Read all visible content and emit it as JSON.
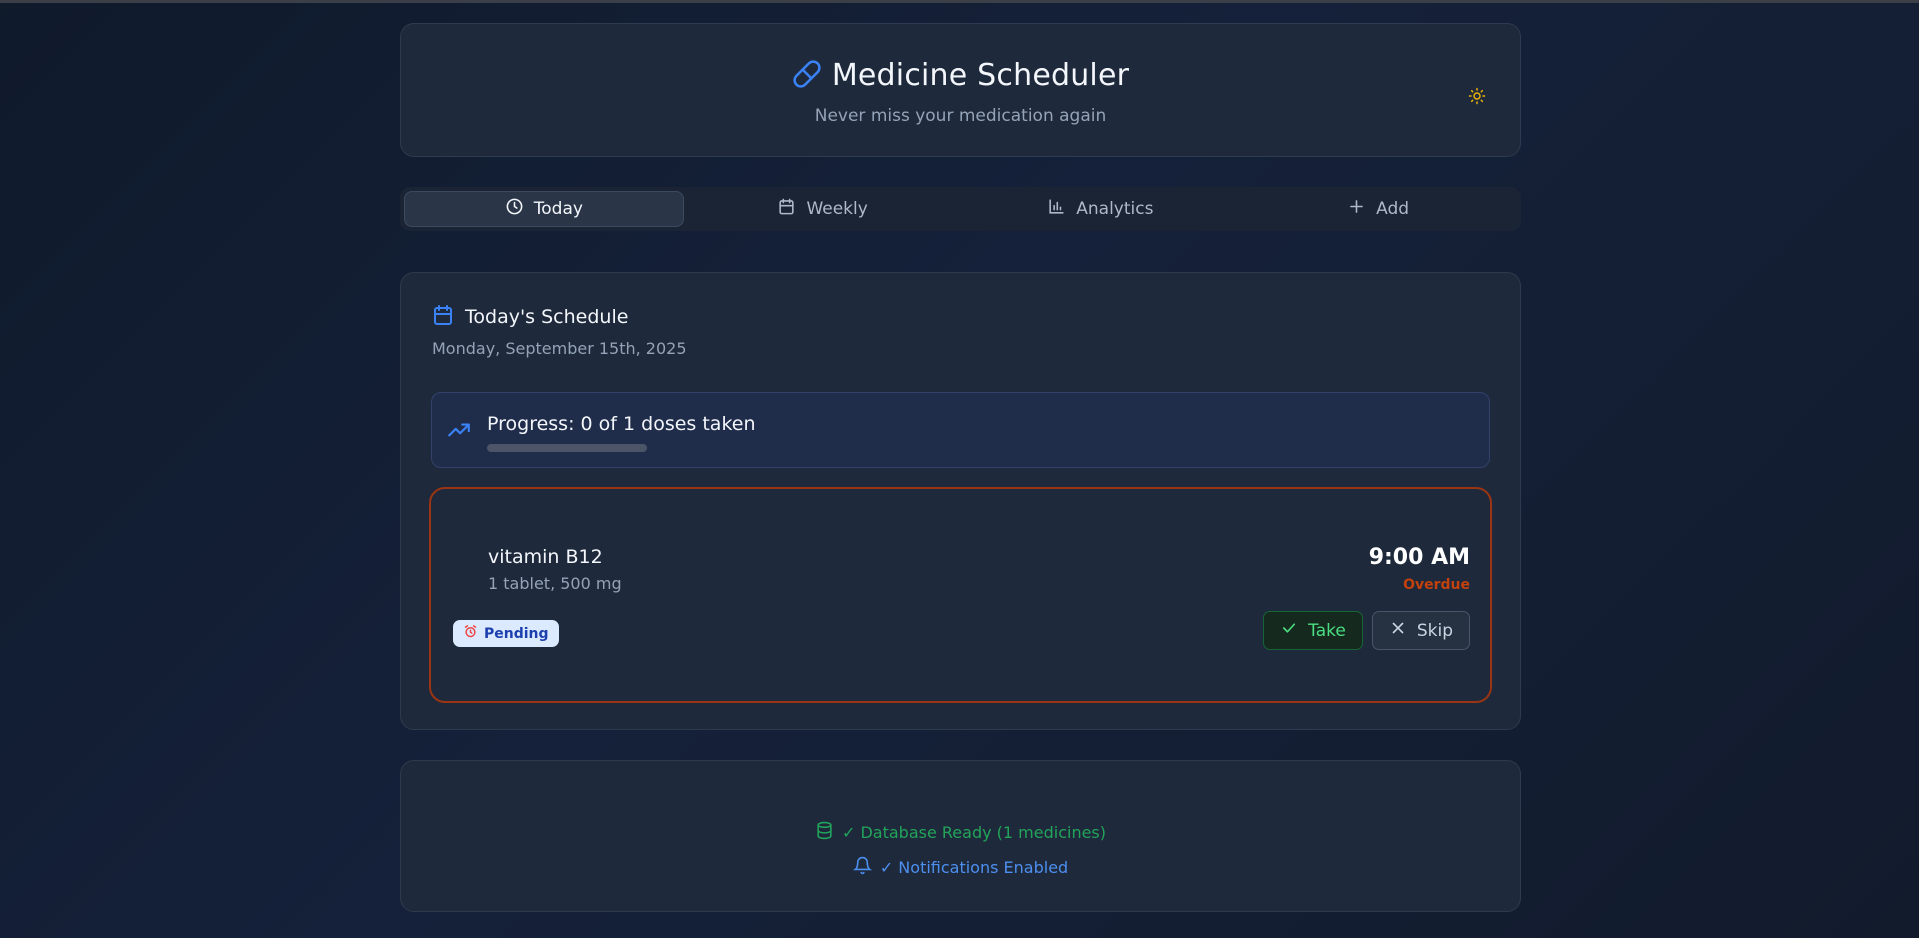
{
  "header": {
    "title": "Medicine Scheduler",
    "subtitle": "Never miss your medication again",
    "theme_icon": "sun-icon"
  },
  "tabs": [
    {
      "label": "Today",
      "icon": "clock-icon",
      "active": true
    },
    {
      "label": "Weekly",
      "icon": "calendar-icon",
      "active": false
    },
    {
      "label": "Analytics",
      "icon": "bar-chart-icon",
      "active": false
    },
    {
      "label": "Add",
      "icon": "plus-icon",
      "active": false
    }
  ],
  "schedule": {
    "title": "Today's Schedule",
    "date": "Monday, September 15th, 2025",
    "progress": {
      "text": "Progress: 0 of 1 doses taken",
      "taken": 0,
      "total": 1
    },
    "doses": [
      {
        "name": "vitamin B12",
        "amount": "1 tablet, 500 mg",
        "status": "Pending",
        "time": "9:00 AM",
        "state": "Overdue",
        "take_label": "Take",
        "skip_label": "Skip"
      }
    ]
  },
  "status": {
    "database": "✓ Database Ready (1 medicines)",
    "notifications": "✓ Notifications Enabled"
  },
  "colors": {
    "accent": "#3b82f6",
    "overdue": "#c2410c",
    "success": "#22a45a",
    "info": "#4d8ff0"
  }
}
